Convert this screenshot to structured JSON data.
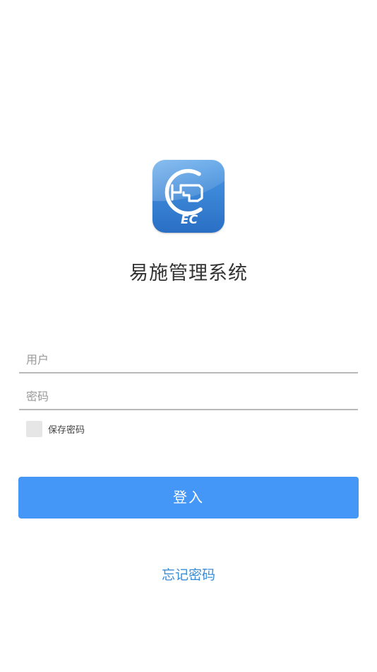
{
  "app": {
    "title": "易施管理系统",
    "icon_name": "ec-logo-icon",
    "icon_text": "EC"
  },
  "form": {
    "username": {
      "placeholder": "用户",
      "value": ""
    },
    "password": {
      "placeholder": "密码",
      "value": ""
    },
    "remember": {
      "label": "保存密码",
      "checked": false
    }
  },
  "actions": {
    "login_label": "登入",
    "forgot_label": "忘记密码"
  },
  "colors": {
    "primary": "#4496f7",
    "link": "#3b8dd6",
    "icon_blue": "#2f7fd0",
    "underline": "#b9b9b9"
  }
}
